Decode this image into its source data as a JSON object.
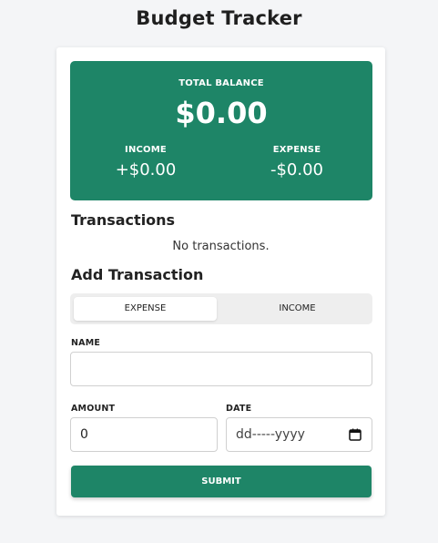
{
  "app": {
    "title": "Budget Tracker"
  },
  "balance": {
    "label": "TOTAL BALANCE",
    "value": "$0.00",
    "income_label": "INCOME",
    "income_value": "+$0.00",
    "expense_label": "EXPENSE",
    "expense_value": "-$0.00",
    "panel_color": "#1e8567"
  },
  "transactions": {
    "title": "Transactions",
    "empty_message": "No transactions."
  },
  "add_transaction": {
    "title": "Add Transaction",
    "type_toggle": {
      "expense_label": "EXPENSE",
      "income_label": "INCOME",
      "selected": "EXPENSE"
    },
    "name_label": "NAME",
    "name_value": "",
    "amount_label": "AMOUNT",
    "amount_value": "0",
    "date_label": "DATE",
    "date_placeholder": "dd-----yyyy",
    "date_icon": "calendar-icon",
    "submit_label": "SUBMIT",
    "accent_color": "#1e8567"
  }
}
